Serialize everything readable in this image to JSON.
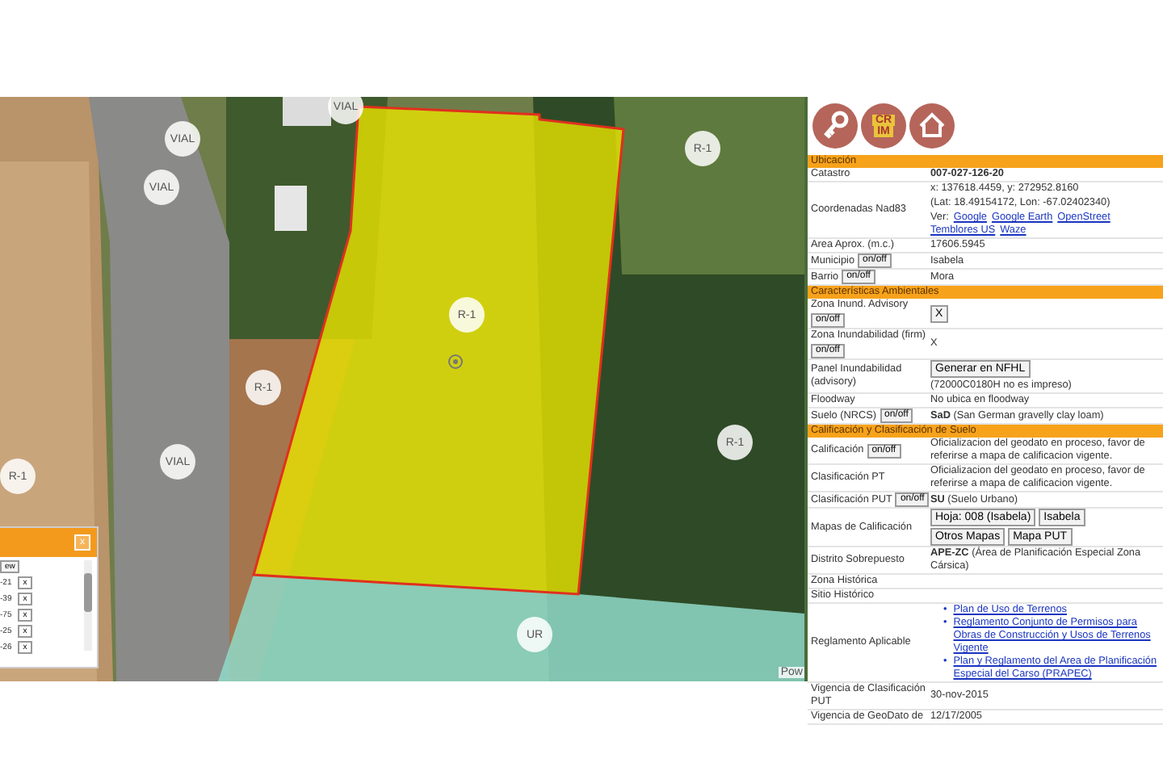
{
  "map": {
    "labels": [
      "VIAL",
      "VIAL",
      "VIAL",
      "VIAL",
      "R-1",
      "R-1",
      "R-1",
      "R-1",
      "R-1",
      "UR"
    ],
    "attribution": "Pow",
    "layer_panel": {
      "close": "x",
      "items": [
        {
          "kind": "button",
          "label": "ew"
        },
        {
          "kind": "layer",
          "label": "-21",
          "remove": "x"
        },
        {
          "kind": "layer",
          "label": "-39",
          "remove": "x"
        },
        {
          "kind": "layer",
          "label": "-75",
          "remove": "x"
        },
        {
          "kind": "layer",
          "label": "-25",
          "remove": "x"
        },
        {
          "kind": "layer",
          "label": "-26",
          "remove": "x"
        }
      ]
    }
  },
  "panel": {
    "logo_text": [
      "CR",
      "IM"
    ],
    "rows": [
      {
        "kind": "header",
        "label": "Ubicación"
      },
      {
        "kind": "row",
        "label": "Catastro",
        "value": "**007-027-126-20**"
      },
      {
        "kind": "row",
        "label": "Coordenadas Nad83",
        "lines": [
          "x: 137618.4459, y: 272952.8160",
          "(Lat: 18.49154172, Lon: -67.02402340)"
        ],
        "links_prefix": "Ver:",
        "links": [
          "Google",
          "Google Earth",
          "OpenStreet",
          "Temblores US",
          "Waze"
        ]
      },
      {
        "kind": "row",
        "label": "Area Aprox. (m.c.)",
        "value": "17606.5945"
      },
      {
        "kind": "row",
        "label": "Municipio",
        "toggle": "on/off",
        "value": "Isabela"
      },
      {
        "kind": "row",
        "label": "Barrio",
        "toggle": "on/off",
        "value": "Mora"
      },
      {
        "kind": "header",
        "label": "Características Ambientales"
      },
      {
        "kind": "row",
        "label": "Zona Inund. Advisory",
        "toggle": "on/off",
        "buttons": [
          "X"
        ]
      },
      {
        "kind": "row",
        "label": "Zona Inundabilidad (firm)",
        "toggle": "on/off",
        "value": "X"
      },
      {
        "kind": "row",
        "label": "Panel Inundabilidad (advisory)",
        "buttons": [
          "Generar en NFHL"
        ],
        "value": "(72000C0180H no es impreso)"
      },
      {
        "kind": "row",
        "label": "Floodway",
        "value": "No ubica en floodway"
      },
      {
        "kind": "row",
        "label": "Suelo (NRCS)",
        "toggle": "on/off",
        "value": "**SaD** (San German gravelly clay loam)"
      },
      {
        "kind": "header",
        "label": "Calificación y Clasificación de Suelo"
      },
      {
        "kind": "row",
        "label": "Calificación",
        "toggle": "on/off",
        "value": "Oficializacion del geodato en proceso, favor de referirse a mapa de calificacion vigente."
      },
      {
        "kind": "row",
        "label": "Clasificación PT",
        "value": "Oficializacion del geodato en proceso, favor de referirse a mapa de calificacion vigente."
      },
      {
        "kind": "row",
        "label": "Clasificación PUT",
        "toggle": "on/off",
        "value": "**SU** (Suelo Urbano)"
      },
      {
        "kind": "row",
        "label": "Mapas de Calificación",
        "buttons": [
          "Hoja: 008 (Isabela)",
          "Isabela",
          "Otros Mapas",
          "Mapa PUT"
        ]
      },
      {
        "kind": "row",
        "label": "Distrito Sobrepuesto",
        "value": "**APE-ZC** (Área de Planificación Especial Zona Cársica)"
      },
      {
        "kind": "row",
        "label": "Zona Histórica"
      },
      {
        "kind": "row",
        "label": "Sitio Histórico"
      },
      {
        "kind": "row",
        "label": "Reglamento Aplicable",
        "bullets": [
          {
            "marker": "•",
            "text": "Plan de Uso de Terrenos"
          },
          {
            "marker": "•",
            "text": "Reglamento Conjunto de Permisos para Obras de Construcción y Usos de Terrenos Vigente"
          },
          {
            "marker": "•",
            "text": "Plan y Reglamento del Area de Planificación Especial del Carso (PRAPEC)"
          }
        ]
      },
      {
        "kind": "row",
        "label": "Vigencia de Clasificación PUT",
        "value": "30-nov-2015"
      },
      {
        "kind": "row",
        "label": "Vigencia de GeoDato de",
        "value": "12/17/2005"
      }
    ]
  }
}
